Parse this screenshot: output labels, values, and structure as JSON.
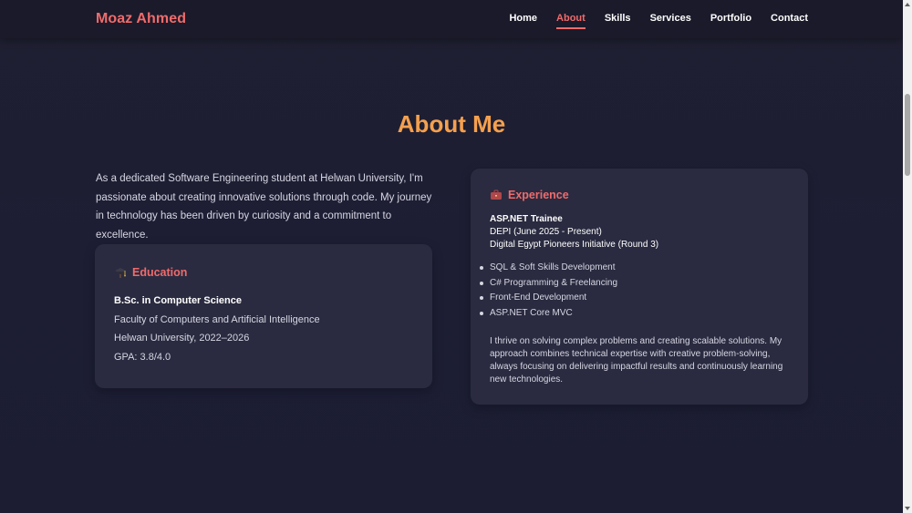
{
  "nav": {
    "brand": "Moaz Ahmed",
    "links": [
      {
        "label": "Home",
        "active": false
      },
      {
        "label": "About",
        "active": true
      },
      {
        "label": "Skills",
        "active": false
      },
      {
        "label": "Services",
        "active": false
      },
      {
        "label": "Portfolio",
        "active": false
      },
      {
        "label": "Contact",
        "active": false
      }
    ]
  },
  "about": {
    "title": "About Me",
    "intro": "As a dedicated Software Engineering student at Helwan University, I'm passionate about creating innovative solutions through code. My journey in technology has been driven by curiosity and a commitment to excellence."
  },
  "education": {
    "icon": "graduation-icon",
    "title": "Education",
    "degree": "B.Sc. in Computer Science",
    "faculty": "Faculty of Computers and Artificial Intelligence",
    "university": "Helwan University, 2022–2026",
    "gpa": "GPA: 3.8/4.0"
  },
  "experience": {
    "icon": "briefcase-icon",
    "title": "Experience",
    "role": "ASP.NET Trainee",
    "org": "DEPI (June 2025 - Present)",
    "program": "Digital Egypt Pioneers Initiative (Round 3)",
    "bullets": [
      "SQL & Soft Skills Development",
      "C# Programming & Freelancing",
      "Front-End Development",
      "ASP.NET Core MVC"
    ],
    "description": "I thrive on solving complex problems and creating scalable solutions. My approach combines technical expertise with creative problem-solving, always focusing on delivering impactful results and continuously learning new technologies."
  },
  "colors": {
    "accent": "#f06b6b",
    "heading": "#f5a04e",
    "background": "#1e1f33",
    "card": "#2a2b40"
  }
}
